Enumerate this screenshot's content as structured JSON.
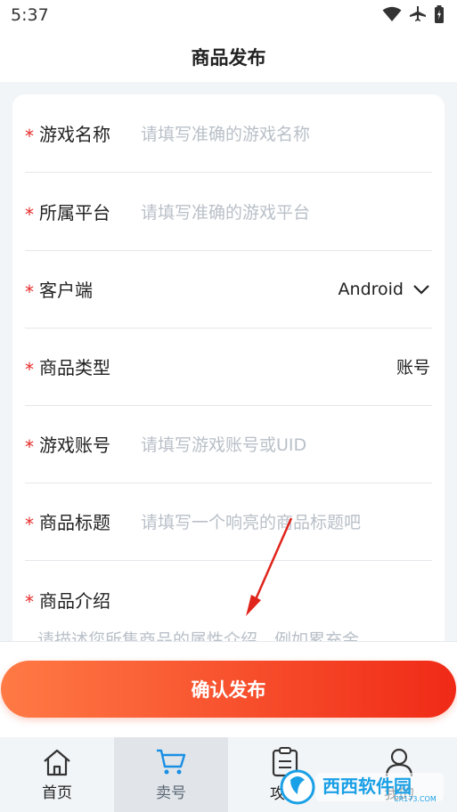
{
  "status": {
    "time": "5:37"
  },
  "header": {
    "title": "商品发布"
  },
  "form": {
    "required_mark": "*",
    "game_name": {
      "label": "游戏名称",
      "placeholder": "请填写准确的游戏名称"
    },
    "platform": {
      "label": "所属平台",
      "placeholder": "请填写准确的游戏平台"
    },
    "client": {
      "label": "客户端",
      "value": "Android"
    },
    "product_type": {
      "label": "商品类型",
      "value": "账号"
    },
    "game_account": {
      "label": "游戏账号",
      "placeholder": "请填写游戏账号或UID"
    },
    "product_title": {
      "label": "商品标题",
      "placeholder": "请填写一个响亮的商品标题吧"
    },
    "product_intro": {
      "label": "商品介绍",
      "placeholder": "请描述您所售商品的属性介绍，例如累充金"
    }
  },
  "confirm_button": {
    "label": "确认发布"
  },
  "tabbar": {
    "items": [
      {
        "label": "首页",
        "icon": "home-icon"
      },
      {
        "label": "卖号",
        "icon": "cart-icon",
        "active": true
      },
      {
        "label": "攻略",
        "icon": "clipboard-icon"
      },
      {
        "label": "我的",
        "icon": "user-icon"
      }
    ]
  },
  "watermark": {
    "text": "西西软件园",
    "subtext": "CR173.COM"
  },
  "colors": {
    "accent_start": "#ff7a45",
    "accent_end": "#f02a17",
    "required": "#e62b2b"
  }
}
